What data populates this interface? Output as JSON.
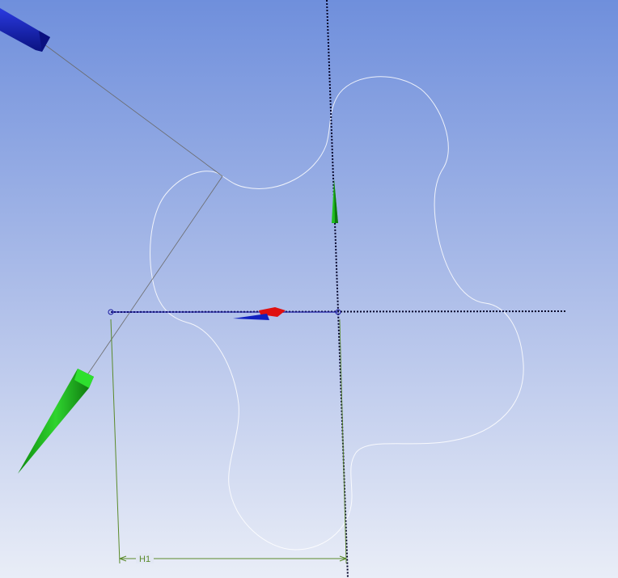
{
  "viewport": {
    "background_top": "#7090dc",
    "background_bottom": "#e8ecf6"
  },
  "sketch": {
    "outline_color": "#ffffff",
    "axis_color": "#000033",
    "sketch_line_color": "#1a1aa0",
    "projection_line_color": "#707070"
  },
  "dimension": {
    "label": "H1",
    "color": "#5a8a2a"
  },
  "triad": {
    "x_color": "#e01010",
    "y_color": "#18c018",
    "z_color": "#1020c0"
  }
}
